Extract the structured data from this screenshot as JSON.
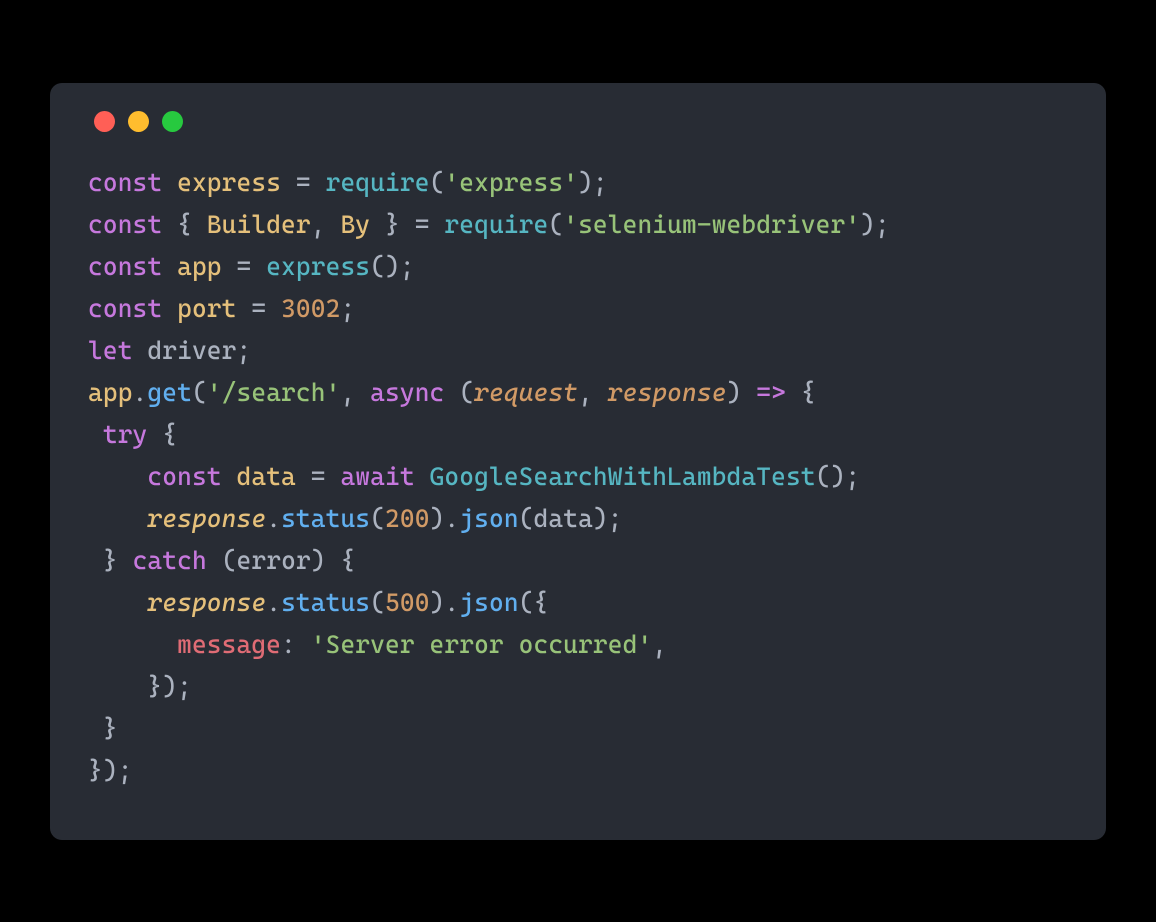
{
  "colors": {
    "bg": "#282c34",
    "red": "#ff5f56",
    "yellow": "#ffbd2e",
    "green": "#27c93f",
    "keyword": "#c678dd",
    "identifier": "#e5c07b",
    "fn": "#56b6c2",
    "callfn": "#61afef",
    "string": "#98c379",
    "number": "#d19a66",
    "plain": "#abb2bf",
    "param": "#d19a66",
    "prop": "#e06c75"
  },
  "tokens": {
    "kw_const": "const",
    "kw_let": "let",
    "kw_async": "async",
    "kw_try": "try",
    "kw_catch": "catch",
    "kw_await": "await",
    "id_express": "express",
    "id_Builder": "Builder",
    "id_By": "By",
    "id_app": "app",
    "id_port": "port",
    "id_driver": "driver",
    "id_data": "data",
    "id_error": "error",
    "fn_require": "require",
    "fn_get": "get",
    "fn_status": "status",
    "fn_json": "json",
    "fn_search": "GoogleSearchWithLambdaTest",
    "str_express": "'express'",
    "str_selenium": "'selenium-webdriver'",
    "str_route": "'/search'",
    "str_msg": "'Server error occurred'",
    "num_3002": "3002",
    "num_200": "200",
    "num_500": "500",
    "param_request": "request",
    "param_response": "response",
    "prop_message": "message",
    "p_eq": " = ",
    "p_osemi": "();",
    "p_open": "(",
    "p_close": ")",
    "p_closesemi": ");",
    "p_obrace": " { ",
    "p_brace_open": " {",
    "p_brace_close": "}",
    "p_brace_close_paren": "});",
    "p_cbrace": " } ",
    "p_comma": ", ",
    "p_semi": ";",
    "p_dot": ".",
    "p_arrow": " => {",
    "p_colon": ": ",
    "p_commaonly": ","
  },
  "indent": {
    "s1": " ",
    "s4": "    ",
    "s6": "      "
  }
}
